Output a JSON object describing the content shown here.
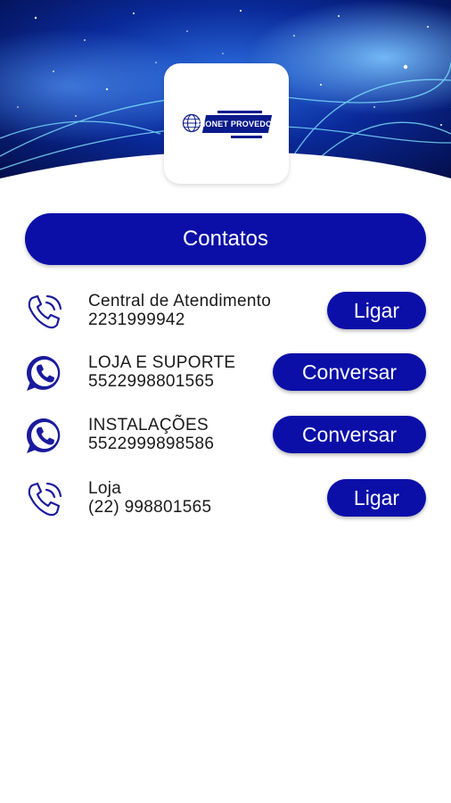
{
  "header": {
    "logo": {
      "brand_text": "RIONET PROVEDOR",
      "icon": "globe-icon"
    }
  },
  "title": "Contatos",
  "contacts": [
    {
      "name": "Central de Atendimento",
      "number": "2231999942",
      "icon": "phone-call-icon",
      "action_label": "Ligar"
    },
    {
      "name": "LOJA E SUPORTE",
      "number": "5522998801565",
      "icon": "whatsapp-icon",
      "action_label": "Conversar"
    },
    {
      "name": "INSTALAÇÕES",
      "number": "5522999898586",
      "icon": "whatsapp-icon",
      "action_label": "Conversar"
    },
    {
      "name": "Loja",
      "number": "(22) 998801565",
      "icon": "phone-call-icon",
      "action_label": "Ligar"
    }
  ],
  "colors": {
    "primary": "#0b0fa8",
    "icon": "#1a1a9e",
    "text": "#1a1a1a"
  }
}
